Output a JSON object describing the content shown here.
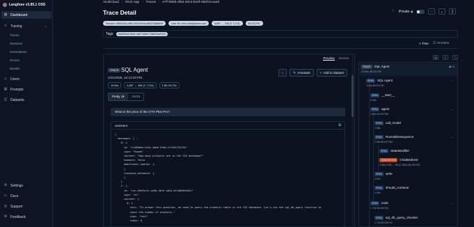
{
  "app": {
    "name": "Langfuse v3.85.1 OSS"
  },
  "nav": {
    "dashboard": "Dashboard",
    "tracing": "Tracing",
    "sub": [
      "Traces",
      "Sessions",
      "Generations",
      "Scores",
      "Models"
    ],
    "users": "Users",
    "prompts": "Prompts",
    "datasets": "Datasets",
    "settings": "Settings",
    "docs": "Docs",
    "support": "Support",
    "feedback": "Feedback"
  },
  "breadcrumb": {
    "org": "VividCloud",
    "project": "RAG App",
    "section": "Traces",
    "trace_id": "e7f7306b-3f54-40c4-b10f-49d7ecca4d"
  },
  "page": {
    "title": "Trace Detail",
    "private_label": "Private"
  },
  "pills": {
    "session": "Session: e852c61a-c5f0-4216-be2a-ab6474d8a649",
    "user": "User ID: chris.vivid@acme.com",
    "tokens": "6,867 → 346 (Σ 7,213)",
    "cost": "$0.021791"
  },
  "tags": {
    "label": "Tags",
    "value": "2a5392a5-b3e1-4de7-b8e4-708a22de341c"
  },
  "view_tabs": {
    "preview": "Preview",
    "scores": "Scores"
  },
  "tree_tabs": {
    "tree": "Tree",
    "timeline": "Timeline"
  },
  "observation": {
    "type": "TRACE",
    "name": "SQL Agent",
    "timestamp": "1/21/2025, 12:12:33 PM",
    "latency": "10.84s",
    "tokens": "6,867 → 346 (Σ 7,213)",
    "cost": "Σ $0.021791",
    "annotate": "Annotate",
    "add_dataset": "Add to dataset",
    "fmt_pretty": "Pretty ✨",
    "fmt_json": "JSON",
    "question": "What is the price of the GTX Plus Pro?",
    "assistant_label": "assistant"
  },
  "code_lines": [
    "{",
    "  messages: [ -",
    "    0: {-",
    "      id: \"1c4066ee-b16c-4ab6-9fdb-fcf3d1f521fb\"",
    "      type: \"human\"",
    "      content: \"How many products are in the CSV database?\"",
    "      example: false",
    "      additional_kwargs: {-",
    "      }",
    "      response_metadata: {-",
    "      }",
    "    }",
    "    1: {-",
    "      id: \"run-e0d7ec5c-ea5b-4b7e-ad24-0f1d8e83e041\"",
    "      type: \"ai\"",
    "      content: [-",
    "        0: {-",
    "          text: \"To answer this question, we need to query the products table in the CSV database. Let's use the sql_db_query function to",
    "          count the number of products.\"",
    "          type: \"text\"",
    "          index: 0"
  ],
  "tree": {
    "root": {
      "type": "TRACE",
      "name": "SQL Agent",
      "meta": "10.84s, $0.021791"
    },
    "nodes": [
      {
        "type": "SPAN",
        "name": "SQL Agent",
        "meta_red": "10.8s",
        "meta": " $0.021791"
      },
      {
        "type": "SPAN",
        "name": "__start__",
        "meta": "0.00s"
      },
      {
        "type": "SPAN",
        "name": "agent",
        "meta": "2.62s  $0.007782"
      },
      {
        "type": "SPAN",
        "name": "call_model",
        "meta": "2.58s"
      },
      {
        "type": "SPAN",
        "name": "RunnableSequence",
        "meta": "2.56s  $0.007782"
      },
      {
        "type": "SPAN",
        "name": "StateModifier",
        "meta": ""
      },
      {
        "type": "GENERATION",
        "name": "ChatBedrock",
        "meta": "2.56s  2706 → 95 (Σ 2801)  $0.007782"
      },
      {
        "type": "SPAN",
        "name": "write",
        "meta": "0.01s"
      },
      {
        "type": "SPAN",
        "name": "should_continue",
        "meta": "0.00s"
      },
      {
        "type": "SPAN",
        "name": "tools",
        "meta": "1.70s  $0.000741"
      },
      {
        "type": "SPAN",
        "name": "sql_db_query_checker",
        "meta": "1.70s  $0.000741"
      }
    ]
  }
}
